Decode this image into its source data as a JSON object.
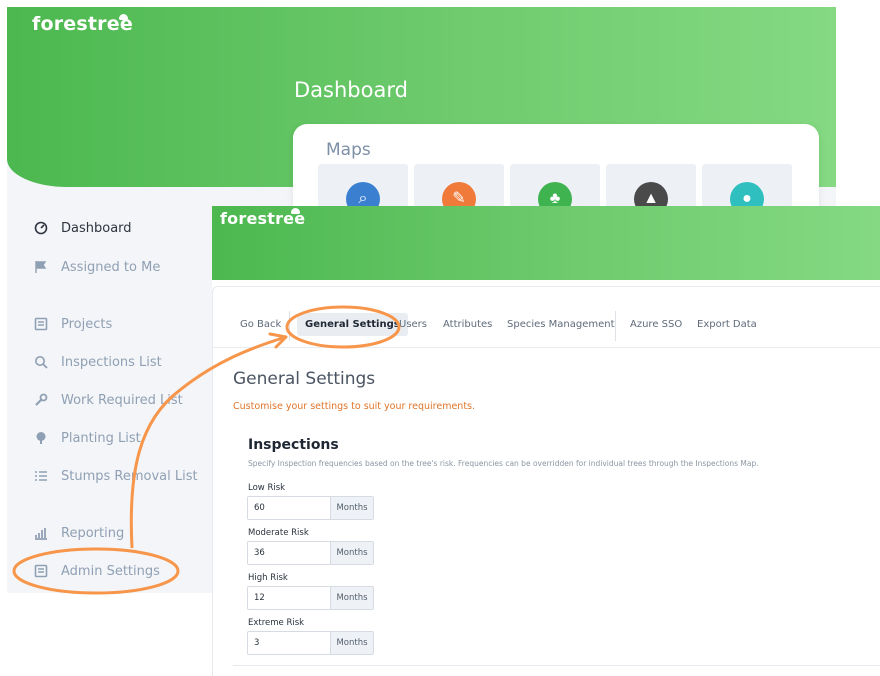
{
  "back": {
    "logo": "forestree",
    "title": "Dashboard",
    "maps_title": "Maps",
    "map_tiles": [
      {
        "icon": "search-icon",
        "color": "#3b7fd0",
        "glyph": "⌕"
      },
      {
        "icon": "wrench-icon",
        "color": "#f07a3a",
        "glyph": "✎"
      },
      {
        "icon": "tree-icon",
        "color": "#3fb34f",
        "glyph": "♣"
      },
      {
        "icon": "stump-icon",
        "color": "#4a4a4a",
        "glyph": "▲"
      },
      {
        "icon": "drop-icon",
        "color": "#2fbfbf",
        "glyph": "●"
      }
    ],
    "sidebar": [
      {
        "label": "Dashboard",
        "icon": "gauge-icon"
      },
      {
        "label": "Assigned to Me",
        "icon": "flag-icon"
      },
      {
        "label": "Projects",
        "icon": "folder-icon"
      },
      {
        "label": "Inspections List",
        "icon": "search-icon"
      },
      {
        "label": "Work Required List",
        "icon": "wrench-icon"
      },
      {
        "label": "Planting List",
        "icon": "tree-icon"
      },
      {
        "label": "Stumps Removal List",
        "icon": "list-icon"
      },
      {
        "label": "Reporting",
        "icon": "bar-chart-icon"
      },
      {
        "label": "Admin Settings",
        "icon": "admin-icon"
      }
    ]
  },
  "front": {
    "logo": "forestree",
    "tabs": [
      {
        "label": "Go Back"
      },
      {
        "label": "General Settings"
      },
      {
        "label": "Users"
      },
      {
        "label": "Attributes"
      },
      {
        "label": "Species Management"
      },
      {
        "label": "Azure SSO"
      },
      {
        "label": "Export Data"
      }
    ],
    "page_title": "General Settings",
    "page_subtitle": "Customise your settings to suit your requirements.",
    "section_title": "Inspections",
    "section_desc": "Specify Inspection frequencies based on the tree's risk. Frequencies can be overridden for individual trees through the Inspections Map.",
    "fields": [
      {
        "label": "Low Risk",
        "value": "60",
        "unit": "Months"
      },
      {
        "label": "Moderate Risk",
        "value": "36",
        "unit": "Months"
      },
      {
        "label": "High Risk",
        "value": "12",
        "unit": "Months"
      },
      {
        "label": "Extreme Risk",
        "value": "3",
        "unit": "Months"
      }
    ]
  },
  "colors": {
    "brand_green": "#4cb84f",
    "annotation_orange": "#f7964a",
    "subtitle_orange": "#e0752b"
  }
}
